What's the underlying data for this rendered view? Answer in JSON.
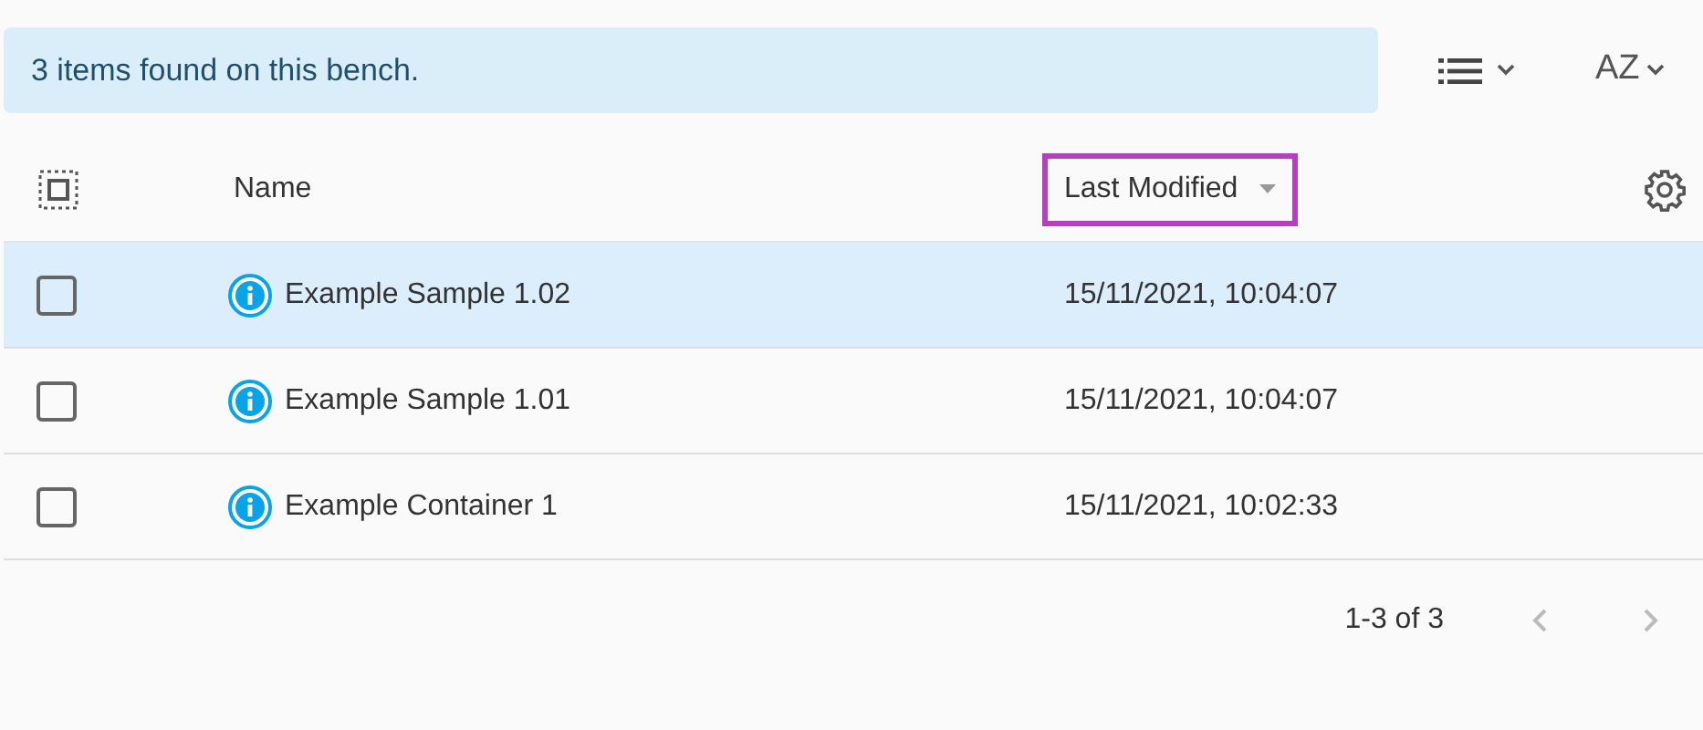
{
  "alert": {
    "text": "3 items found on this bench."
  },
  "toolbar": {
    "sort_label": "AZ"
  },
  "table": {
    "columns": [
      {
        "label": "Name",
        "sortable": false,
        "highlighted": false
      },
      {
        "label": "Last Modified",
        "sortable": true,
        "highlighted": true
      }
    ],
    "rows": [
      {
        "name": "Example Sample 1.02",
        "modified": "15/11/2021, 10:04:07",
        "selected": true,
        "checked": false
      },
      {
        "name": "Example Sample 1.01",
        "modified": "15/11/2021, 10:04:07",
        "selected": false,
        "checked": false
      },
      {
        "name": "Example Container 1",
        "modified": "15/11/2021, 10:02:33",
        "selected": false,
        "checked": false
      }
    ]
  },
  "pagination": {
    "range": "1-3 of 3",
    "prev_disabled": true,
    "next_disabled": true
  }
}
